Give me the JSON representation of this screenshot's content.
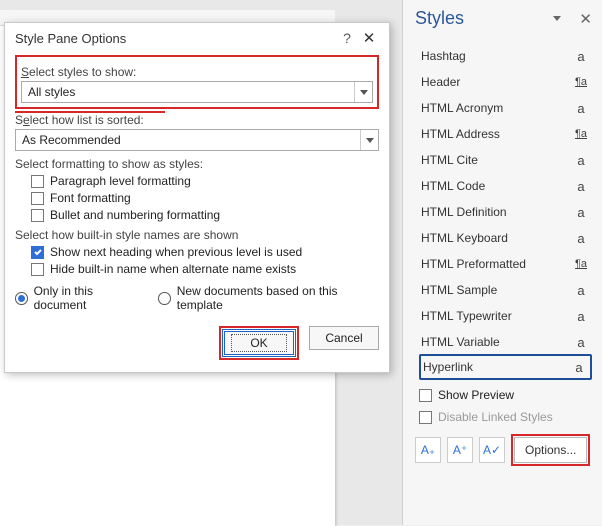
{
  "dialog": {
    "title": "Style Pane Options",
    "labels": {
      "select_styles": "Select styles to show:",
      "how_sorted": "Select how list is sorted:",
      "formatting_show": "Select formatting to show as styles:",
      "builtin_shown": "Select how built-in style names are shown"
    },
    "combos": {
      "styles_to_show": "All styles",
      "sort": "As Recommended"
    },
    "checkboxes": {
      "paragraph": "Paragraph level formatting",
      "font": "Font formatting",
      "bullet": "Bullet and numbering formatting",
      "show_next": "Show next heading when previous level is used",
      "hide_builtin": "Hide built-in name when alternate name exists"
    },
    "radios": {
      "only_doc": "Only in this document",
      "new_docs": "New documents based on this template"
    },
    "buttons": {
      "ok": "OK",
      "cancel": "Cancel"
    }
  },
  "pane": {
    "title": "Styles",
    "items": [
      {
        "name": "Hashtag",
        "glyph": "a"
      },
      {
        "name": "Header",
        "glyph": "¶a"
      },
      {
        "name": "HTML Acronym",
        "glyph": "a"
      },
      {
        "name": "HTML Address",
        "glyph": "¶a"
      },
      {
        "name": "HTML Cite",
        "glyph": "a"
      },
      {
        "name": "HTML Code",
        "glyph": "a"
      },
      {
        "name": "HTML Definition",
        "glyph": "a"
      },
      {
        "name": "HTML Keyboard",
        "glyph": "a"
      },
      {
        "name": "HTML Preformatted",
        "glyph": "¶a"
      },
      {
        "name": "HTML Sample",
        "glyph": "a"
      },
      {
        "name": "HTML Typewriter",
        "glyph": "a"
      },
      {
        "name": "HTML Variable",
        "glyph": "a"
      },
      {
        "name": "Hyperlink",
        "glyph": "a"
      }
    ],
    "show_preview": "Show Preview",
    "disable_linked": "Disable Linked Styles",
    "options": "Options..."
  }
}
